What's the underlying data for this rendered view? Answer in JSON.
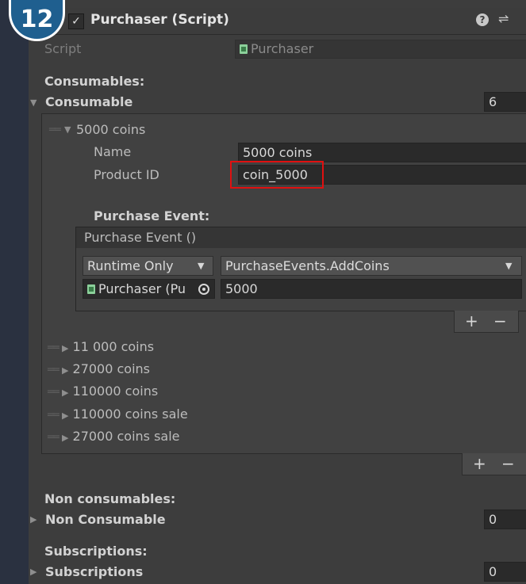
{
  "badge": "12",
  "component": {
    "title": "Purchaser (Script)",
    "enabled": true
  },
  "script_row": {
    "label": "Script",
    "value": "Purchaser"
  },
  "consumables": {
    "section_label": "Consumables:",
    "list_label": "Consumable",
    "count": "6",
    "expanded_item": {
      "title": "5000 coins",
      "name_label": "Name",
      "name_value": "5000 coins",
      "product_id_label": "Product ID",
      "product_id_value": "coin_5000",
      "purchase_event_label": "Purchase Event:",
      "event_header": "Purchase Event ()",
      "runtime_option": "Runtime Only",
      "function_option": "PurchaseEvents.AddCoins",
      "target_object": "Purchaser (Pu",
      "argument": "5000"
    },
    "items": [
      "11 000 coins",
      "27000 coins",
      "110000 coins",
      "110000 coins sale",
      "27000 coins sale"
    ]
  },
  "non_consumables": {
    "section_label": "Non consumables:",
    "list_label": "Non Consumable",
    "count": "0"
  },
  "subscriptions": {
    "section_label": "Subscriptions:",
    "list_label": "Subscriptions",
    "count": "0"
  },
  "buttons": {
    "plus": "+",
    "minus": "−"
  },
  "colors": {
    "highlight": "#e01010",
    "badge": "#1f5f8f"
  }
}
